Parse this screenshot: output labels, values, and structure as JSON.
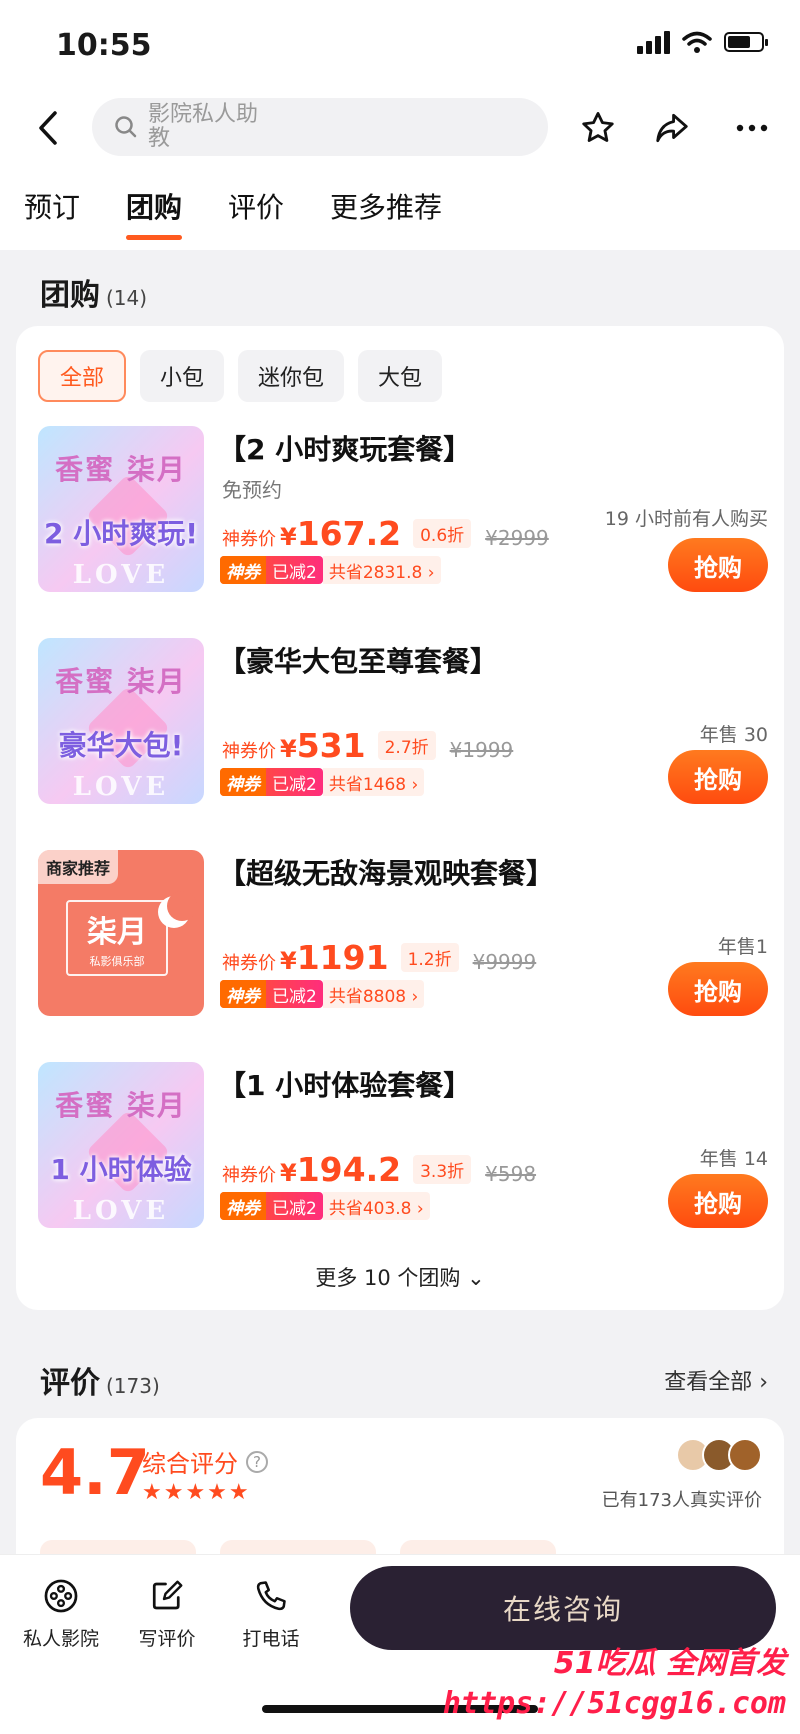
{
  "status_bar": {
    "time": "10:55"
  },
  "header": {
    "search_placeholder": "影院私人助教"
  },
  "tabs": [
    {
      "label": "预订",
      "active": false
    },
    {
      "label": "团购",
      "active": true
    },
    {
      "label": "评价",
      "active": false
    },
    {
      "label": "更多推荐",
      "active": false
    }
  ],
  "group_buy": {
    "title": "团购",
    "count": "(14)",
    "filters": [
      "全部",
      "小包",
      "迷你包",
      "大包"
    ],
    "deals": [
      {
        "name": "【2 小时爽玩套餐】",
        "sub": "免预约",
        "price_label": "神券价",
        "currency": "¥",
        "price": "167.2",
        "discount": "0.6折",
        "original": "¥2999",
        "badge_left": "神券",
        "badge_right": "已减2",
        "saving": "共省2831.8 ›",
        "sold": "19 小时前有人购买",
        "buy": "抢购",
        "thumb_title": "香蜜 柒月",
        "thumb_text": "2 小时爽玩!",
        "thumb_love": "LOVE"
      },
      {
        "name": "【豪华大包至尊套餐】",
        "price_label": "神券价",
        "currency": "¥",
        "price": "531",
        "discount": "2.7折",
        "original": "¥1999",
        "badge_left": "神券",
        "badge_right": "已减2",
        "saving": "共省1468 ›",
        "sold": "年售 30",
        "buy": "抢购",
        "thumb_title": "香蜜 柒月",
        "thumb_text": "豪华大包!",
        "thumb_love": "LOVE"
      },
      {
        "name": "【超级无敌海景观映套餐】",
        "price_label": "神券价",
        "currency": "¥",
        "price": "1191",
        "discount": "1.2折",
        "original": "¥9999",
        "badge_left": "神券",
        "badge_right": "已减2",
        "saving": "共省8808 ›",
        "sold": "年售1",
        "buy": "抢购",
        "thumb_tag": "商家推荐",
        "thumb_logo": "柒月",
        "thumb_logo_sub": "私影俱乐部"
      },
      {
        "name": "【1 小时体验套餐】",
        "price_label": "神券价",
        "currency": "¥",
        "price": "194.2",
        "discount": "3.3折",
        "original": "¥598",
        "badge_left": "神券",
        "badge_right": "已减2",
        "saving": "共省403.8 ›",
        "sold": "年售 14",
        "buy": "抢购",
        "thumb_title": "香蜜 柒月",
        "thumb_text": "1 小时体验",
        "thumb_love": "LOVE"
      }
    ],
    "more": "更多 10 个团购 ⌄"
  },
  "reviews": {
    "title": "评价",
    "count": "(173)",
    "see_all": "查看全部 ›",
    "score": "4.7",
    "score_label": "综合评分",
    "help": "?",
    "stars": "★★★★★",
    "real": "已有173人真实评价"
  },
  "bottom_bar": {
    "items": [
      "私人影院",
      "写评价",
      "打电话"
    ],
    "consult": "在线咨询"
  },
  "watermark": {
    "line1": "51吃瓜 全网首发",
    "line2": "https://51cgg16.com"
  },
  "colors": {
    "accent": "#ff4b1f",
    "consult_bg": "#2a2133"
  }
}
